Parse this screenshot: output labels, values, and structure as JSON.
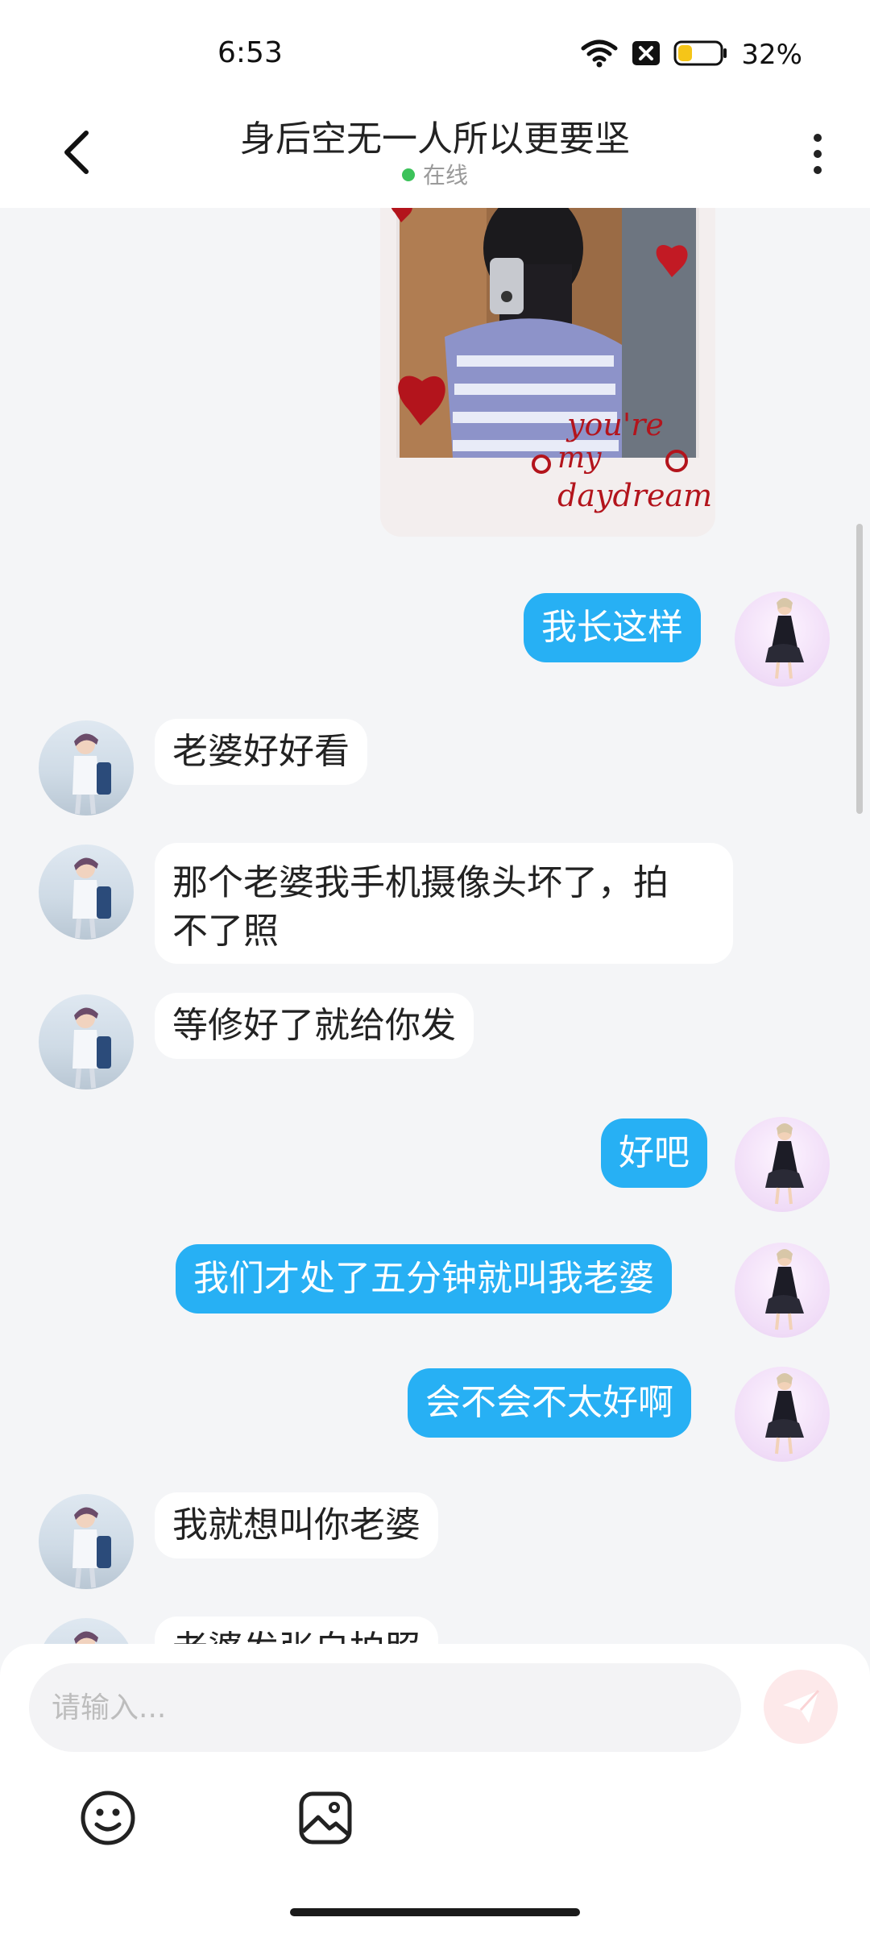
{
  "status_bar": {
    "time": "6:53",
    "battery": "32%",
    "battery_level": 0.32,
    "icons": [
      "wifi-icon",
      "sim-disabled-icon",
      "battery-icon"
    ]
  },
  "header": {
    "title": "身后空无一人所以更要坚",
    "status": "在线",
    "status_color": "#3cc25a",
    "back_icon": "chevron-left-icon",
    "more_icon": "more-vertical-icon"
  },
  "photo_message": {
    "caption_text": "you're my daydream"
  },
  "messages": [
    {
      "side": "right",
      "text": "我长这样"
    },
    {
      "side": "left",
      "text": "老婆好好看"
    },
    {
      "side": "left",
      "text": "那个老婆我手机摄像头坏了，拍\n不了照"
    },
    {
      "side": "left",
      "text": "等修好了就给你发"
    },
    {
      "side": "right",
      "text": "好吧"
    },
    {
      "side": "right",
      "text": "我们才处了五分钟就叫我老婆"
    },
    {
      "side": "right",
      "text": "会不会不太好啊"
    },
    {
      "side": "left",
      "text": "我就想叫你老婆"
    },
    {
      "side": "left",
      "text": "老婆发张自拍照"
    }
  ],
  "input": {
    "placeholder": "请输入...",
    "value": ""
  },
  "toolbar": {
    "emoji_icon": "smiley-icon",
    "image_icon": "image-icon",
    "send_icon": "paper-plane-icon"
  },
  "colors": {
    "outgoing_bubble": "#27b0f4",
    "incoming_bubble": "#ffffff",
    "chat_background": "#f4f5f7"
  }
}
